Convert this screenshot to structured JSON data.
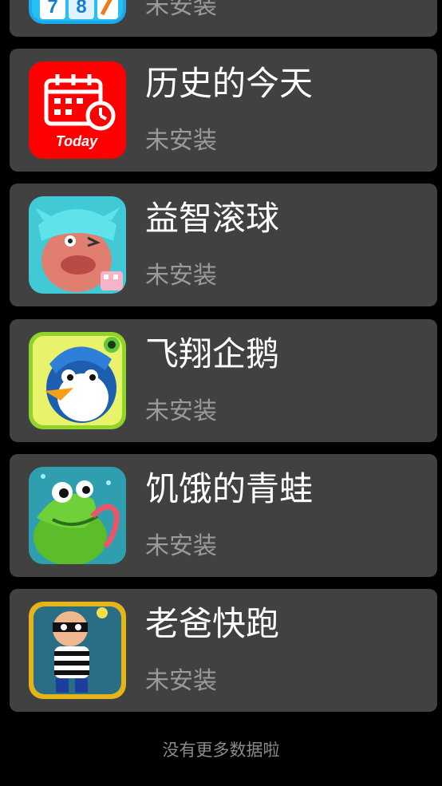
{
  "apps": [
    {
      "name": "",
      "status": "未安装",
      "icon": "number-puzzle-icon"
    },
    {
      "name": "历史的今天",
      "status": "未安装",
      "icon": "today-calendar-icon"
    },
    {
      "name": "益智滚球",
      "status": "未安装",
      "icon": "cyan-creature-icon"
    },
    {
      "name": "飞翔企鹅",
      "status": "未安装",
      "icon": "penguin-icon"
    },
    {
      "name": "饥饿的青蛙",
      "status": "未安装",
      "icon": "frog-icon"
    },
    {
      "name": "老爸快跑",
      "status": "未安装",
      "icon": "robber-icon"
    }
  ],
  "calendar_icon_text": "Today",
  "icon_tiles": [
    "7",
    "8"
  ],
  "footer": {
    "text": "没有更多数据啦"
  },
  "colors": {
    "background": "#000000",
    "card": "#414141",
    "title": "#ffffff",
    "status": "#9a9a9a",
    "footer": "#8a8a8a"
  }
}
